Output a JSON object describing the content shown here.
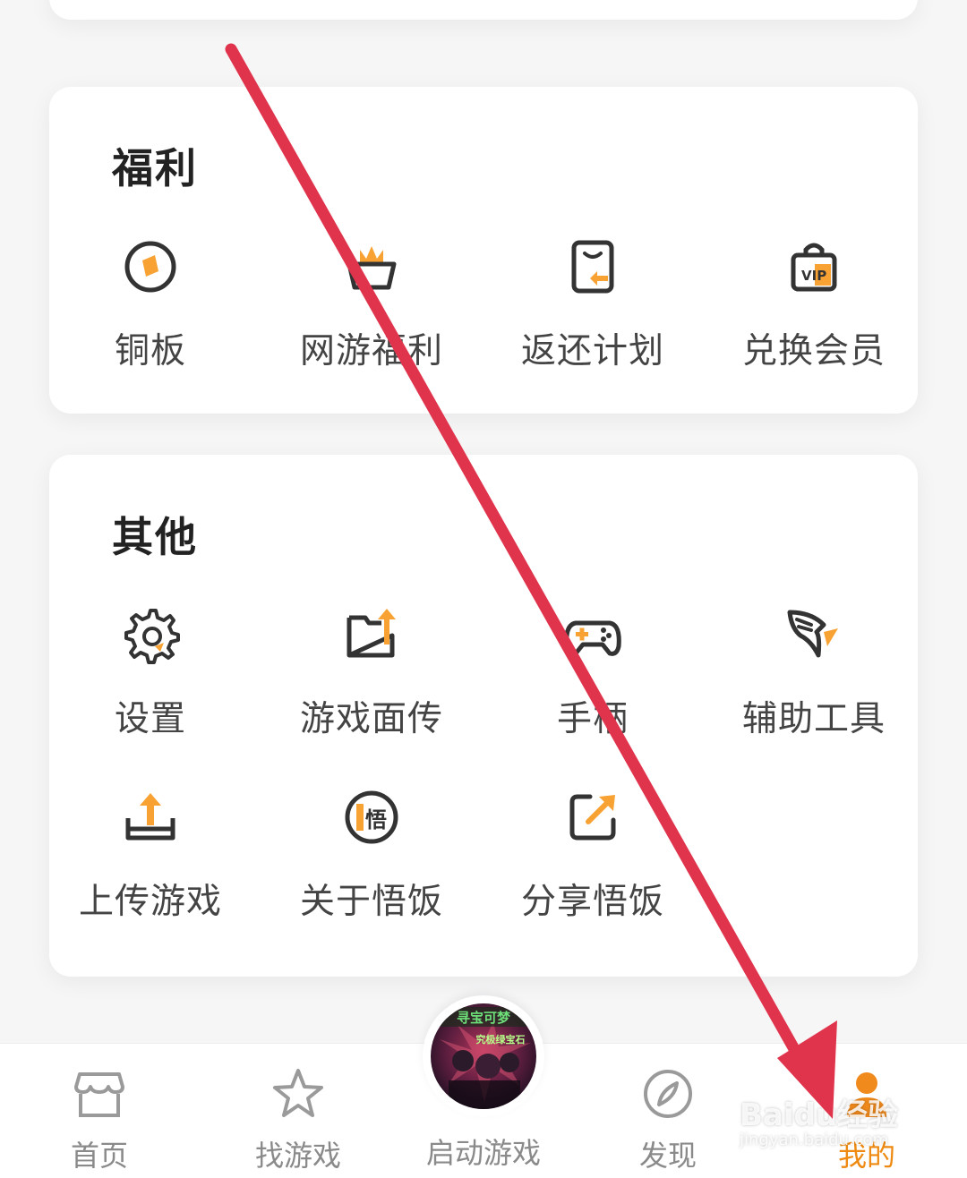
{
  "sections": {
    "fuli": {
      "title": "福利",
      "items": [
        {
          "label": "铜板",
          "icon": "coin-icon"
        },
        {
          "label": "网游福利",
          "icon": "crown-basket-icon"
        },
        {
          "label": "返还计划",
          "icon": "return-plan-icon"
        },
        {
          "label": "兑换会员",
          "icon": "vip-bag-icon"
        }
      ]
    },
    "other": {
      "title": "其他",
      "items": [
        {
          "label": "设置",
          "icon": "gear-icon"
        },
        {
          "label": "游戏面传",
          "icon": "folder-upload-icon"
        },
        {
          "label": "手柄",
          "icon": "gamepad-icon"
        },
        {
          "label": "辅助工具",
          "icon": "winged-tool-icon"
        },
        {
          "label": "上传游戏",
          "icon": "upload-tray-icon"
        },
        {
          "label": "关于悟饭",
          "icon": "wufan-logo-icon"
        },
        {
          "label": "分享悟饭",
          "icon": "share-icon"
        }
      ]
    }
  },
  "nav": {
    "items": [
      {
        "label": "首页",
        "icon": "home-store-icon",
        "active": false
      },
      {
        "label": "找游戏",
        "icon": "star-icon",
        "active": false
      },
      {
        "label": "启动游戏",
        "icon": "game-cover-icon",
        "active": false
      },
      {
        "label": "发现",
        "icon": "compass-icon",
        "active": false
      },
      {
        "label": "我的",
        "icon": "user-icon",
        "active": true
      }
    ]
  },
  "launch_cover_text": {
    "line1": "寻宝可梦",
    "line2": "究极绿宝石"
  },
  "watermark": {
    "brand": "Baidu经验",
    "url": "jingyan.baidu.com"
  },
  "colors": {
    "accent": "#f7a233",
    "active_nav": "#ee8a12",
    "arrow": "#e0344d",
    "icon_stroke": "#333333"
  }
}
